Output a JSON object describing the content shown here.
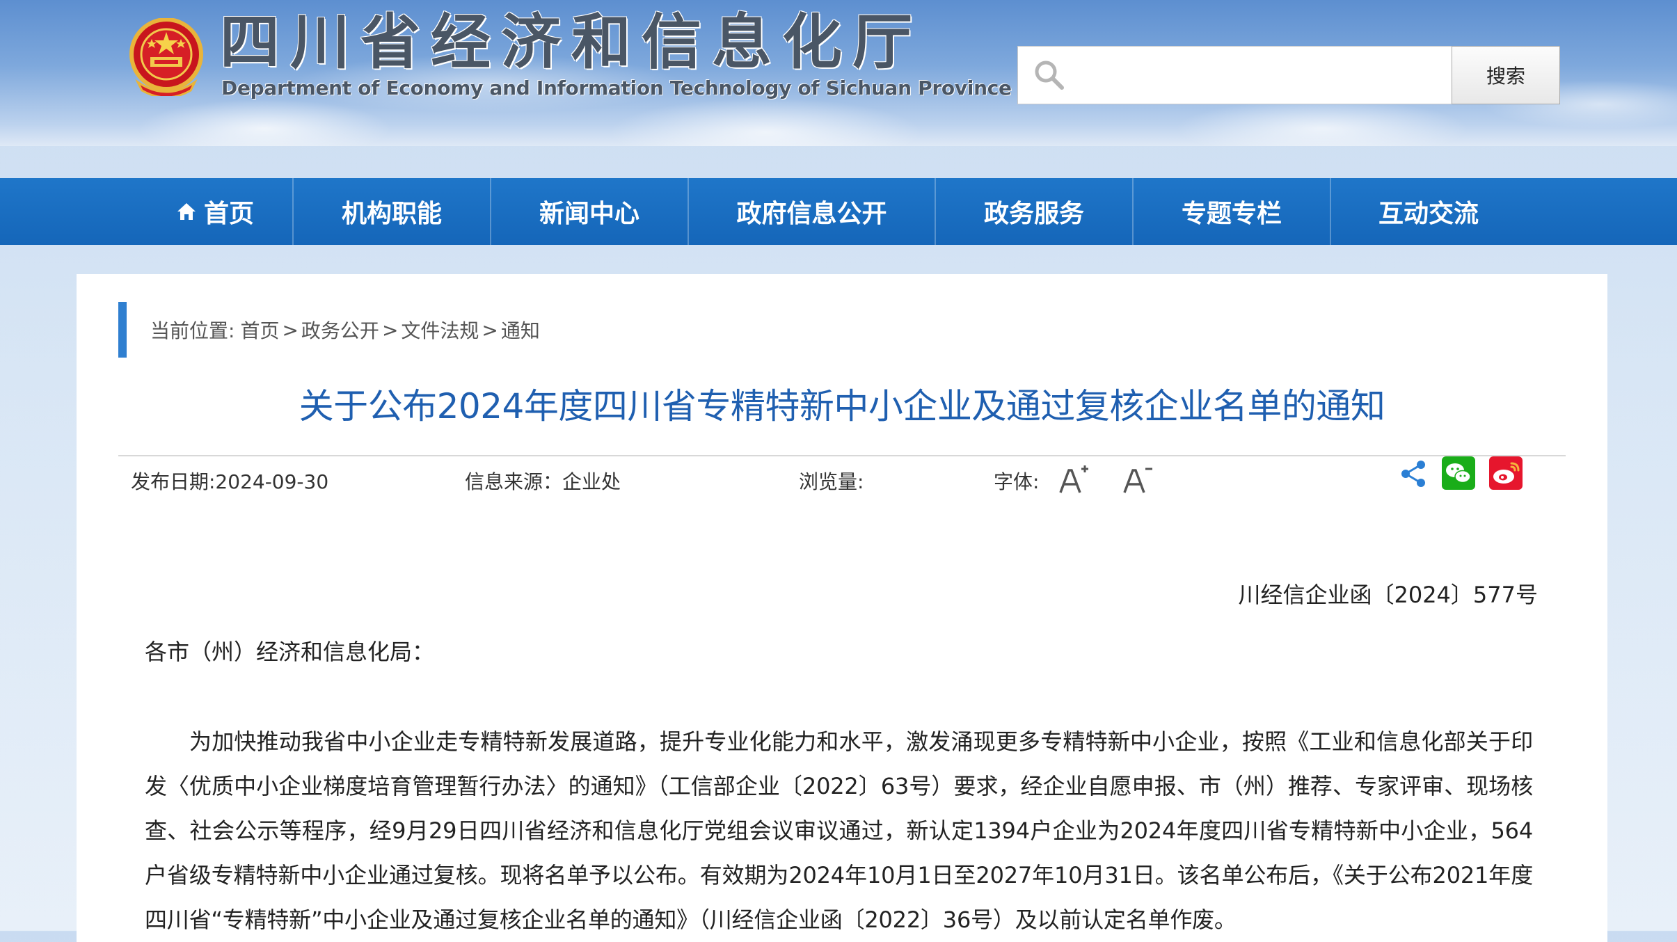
{
  "header": {
    "title": "四川省经济和信息化厅",
    "subtitle": "Department of Economy and Information Technology of Sichuan Province",
    "emblem_icon": "national-emblem-icon"
  },
  "search": {
    "placeholder": "",
    "button_label": "搜索",
    "icon": "search-icon"
  },
  "nav": {
    "items": [
      {
        "label": "首页",
        "icon": "home-icon"
      },
      {
        "label": "机构职能"
      },
      {
        "label": "新闻中心"
      },
      {
        "label": "政府信息公开"
      },
      {
        "label": "政务服务"
      },
      {
        "label": "专题专栏"
      },
      {
        "label": "互动交流"
      }
    ]
  },
  "breadcrumb": {
    "prefix": "当前位置:",
    "items": [
      "首页",
      "政务公开",
      "文件法规",
      "通知"
    ],
    "separator": ">"
  },
  "article": {
    "title": "关于公布2024年度四川省专精特新中小企业及通过复核企业名单的通知",
    "meta": {
      "date": "发布日期:2024-09-30",
      "source": "信息来源：企业处",
      "views": "浏览量:",
      "font_label": "字体:"
    },
    "doc_number": "川经信企业函〔2024〕577号",
    "salutation": "各市（州）经济和信息化局：",
    "body": "为加快推动我省中小企业走专精特新发展道路，提升专业化能力和水平，激发涌现更多专精特新中小企业，按照《工业和信息化部关于印发〈优质中小企业梯度培育管理暂行办法〉的通知》（工信部企业〔2022〕63号）要求，经企业自愿申报、市（州）推荐、专家评审、现场核查、社会公示等程序，经9月29日四川省经济和信息化厅党组会议审议通过，新认定1394户企业为2024年度四川省专精特新中小企业，564户省级专精特新中小企业通过复核。现将名单予以公布。有效期为2024年10月1日至2027年10月31日。该名单公布后，《关于公布2021年度四川省“专精特新”中小企业及通过复核企业名单的通知》（川经信企业函〔2022〕36号）及以前认定名单作废。"
  },
  "colors": {
    "nav_bg": "#1566b9",
    "title": "#1f5fb0",
    "breadcrumb_bar": "#2f7fd0",
    "wechat": "#1aad19",
    "weibo": "#e6162d",
    "share": "#2b7fd4"
  }
}
